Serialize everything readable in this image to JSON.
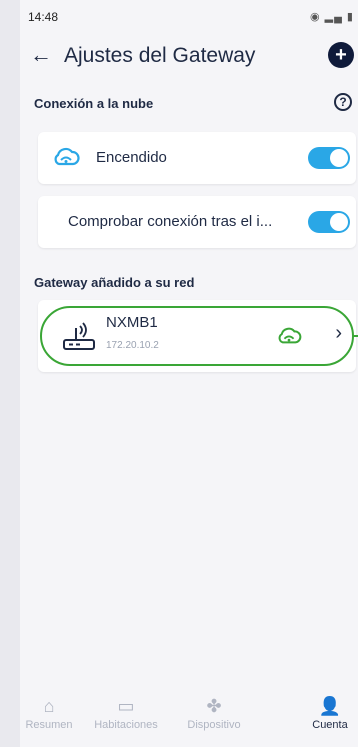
{
  "status_bar": {
    "time": "14:48",
    "icons": "◉ ▂▄ ▮"
  },
  "header": {
    "title": "Ajustes del Gateway",
    "add": "+"
  },
  "cloud_section": {
    "title": "Conexión a la nube",
    "help": "?",
    "items": [
      {
        "label": "Encendido",
        "enabled": true
      },
      {
        "label": "Comprobar conexión tras el i...",
        "enabled": true
      }
    ]
  },
  "gateway_section": {
    "title": "Gateway añadido a su red",
    "gateway": {
      "name": "NXMB1",
      "ip": "172.20.10.2"
    }
  },
  "bottom_nav": {
    "items": [
      {
        "label": "Resumen",
        "icon": "home-icon"
      },
      {
        "label": "Habitaciones",
        "icon": "sofa-icon"
      },
      {
        "label": "Dispositivo",
        "icon": "fan-icon"
      },
      {
        "label": "Cuenta",
        "icon": "user-icon",
        "active": true
      }
    ]
  },
  "colors": {
    "accent": "#2aa7e6",
    "brand": "#1f2a44",
    "highlight": "#3aa636"
  }
}
